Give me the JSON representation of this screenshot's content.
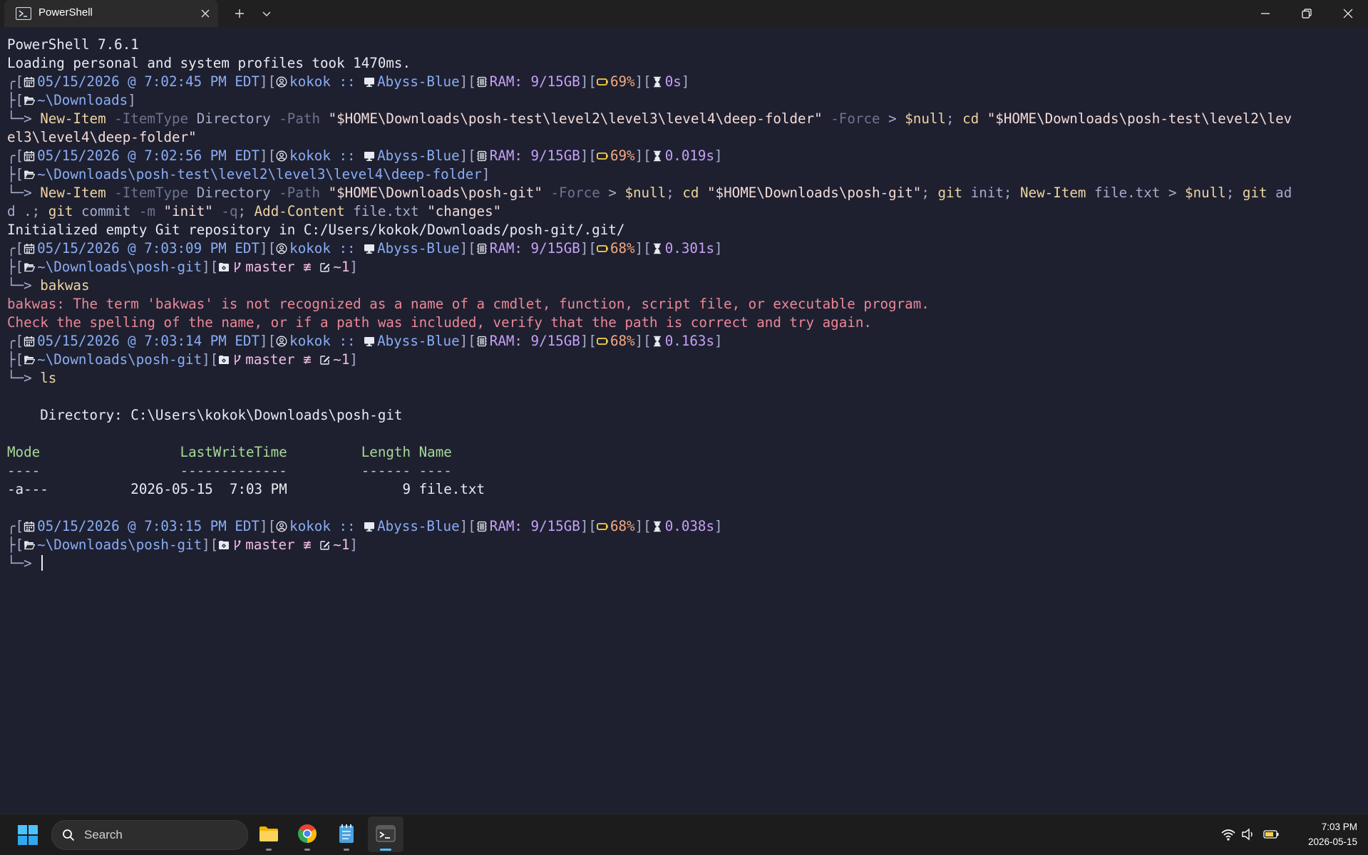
{
  "colors": {
    "terminal_bg": "#1e2030",
    "titlebar_bg": "#202020",
    "taskbar_bg": "#1c1c1c",
    "accent": "#4cc2ff",
    "error": "#ed8796"
  },
  "window": {
    "tab_title": "PowerShell",
    "tab_icon": "powershell-icon",
    "controls": [
      "minimize-icon",
      "restore-icon",
      "close-icon"
    ]
  },
  "terminal": {
    "lines": [
      {
        "kind": "text",
        "segs": [
          {
            "t": "PowerShell 7.6.1",
            "c": "white"
          }
        ]
      },
      {
        "kind": "text",
        "segs": [
          {
            "t": "Loading personal and system profiles took 1470ms.",
            "c": "white"
          }
        ]
      },
      {
        "kind": "prompt1",
        "date": "05/15/2026 @ 7:02:45 PM EDT",
        "user": "kokok",
        "host": "Abyss-Blue",
        "ram": "RAM: 9/15GB",
        "battery": "69%",
        "duration": "0s"
      },
      {
        "kind": "prompt2",
        "path": "~\\Downloads"
      },
      {
        "kind": "cmd",
        "arrow": "└─> ",
        "segs": [
          {
            "t": "New-Item",
            "c": "yellow"
          },
          {
            "t": " -ItemType",
            "c": "dim"
          },
          {
            "t": " Directory",
            "c": "gray"
          },
          {
            "t": " -Path",
            "c": "dim"
          },
          {
            "t": " \"$HOME\\Downloads\\posh-test\\level2\\level3\\level4\\deep-folder\"",
            "c": "rose"
          },
          {
            "t": " -Force",
            "c": "dim"
          },
          {
            "t": " >",
            "c": "gray"
          },
          {
            "t": " $null",
            "c": "yellow"
          },
          {
            "t": ";",
            "c": "gray"
          },
          {
            "t": " cd",
            "c": "yellow"
          },
          {
            "t": " \"$HOME\\Downloads\\posh-test\\level2\\lev",
            "c": "rose"
          }
        ]
      },
      {
        "kind": "text",
        "segs": [
          {
            "t": "el3\\level4\\deep-folder\"",
            "c": "rose"
          }
        ]
      },
      {
        "kind": "prompt1",
        "date": "05/15/2026 @ 7:02:56 PM EDT",
        "user": "kokok",
        "host": "Abyss-Blue",
        "ram": "RAM: 9/15GB",
        "battery": "69%",
        "duration": "0.019s"
      },
      {
        "kind": "prompt2",
        "path": "~\\Downloads\\posh-test\\level2\\level3\\level4\\deep-folder"
      },
      {
        "kind": "cmd",
        "arrow": "└─> ",
        "segs": [
          {
            "t": "New-Item",
            "c": "yellow"
          },
          {
            "t": " -ItemType",
            "c": "dim"
          },
          {
            "t": " Directory",
            "c": "gray"
          },
          {
            "t": " -Path",
            "c": "dim"
          },
          {
            "t": " \"$HOME\\Downloads\\posh-git\"",
            "c": "rose"
          },
          {
            "t": " -Force",
            "c": "dim"
          },
          {
            "t": " >",
            "c": "gray"
          },
          {
            "t": " $null",
            "c": "yellow"
          },
          {
            "t": ";",
            "c": "gray"
          },
          {
            "t": " cd",
            "c": "yellow"
          },
          {
            "t": " \"$HOME\\Downloads\\posh-git\"",
            "c": "rose"
          },
          {
            "t": ";",
            "c": "gray"
          },
          {
            "t": " git",
            "c": "yellow"
          },
          {
            "t": " init",
            "c": "gray"
          },
          {
            "t": ";",
            "c": "gray"
          },
          {
            "t": " New-Item",
            "c": "yellow"
          },
          {
            "t": " file.txt",
            "c": "gray"
          },
          {
            "t": " >",
            "c": "gray"
          },
          {
            "t": " $null",
            "c": "yellow"
          },
          {
            "t": ";",
            "c": "gray"
          },
          {
            "t": " git",
            "c": "yellow"
          },
          {
            "t": " ad",
            "c": "gray"
          }
        ]
      },
      {
        "kind": "text",
        "segs": [
          {
            "t": "d .;",
            "c": "gray"
          },
          {
            "t": " git",
            "c": "yellow"
          },
          {
            "t": " commit",
            "c": "gray"
          },
          {
            "t": " -m",
            "c": "dim"
          },
          {
            "t": " \"init\"",
            "c": "rose"
          },
          {
            "t": " -q",
            "c": "dim"
          },
          {
            "t": ";",
            "c": "gray"
          },
          {
            "t": " Add-Content",
            "c": "yellow"
          },
          {
            "t": " file.txt",
            "c": "gray"
          },
          {
            "t": " \"changes\"",
            "c": "rose"
          }
        ]
      },
      {
        "kind": "text",
        "segs": [
          {
            "t": "Initialized empty Git repository in C:/Users/kokok/Downloads/posh-git/.git/",
            "c": "white"
          }
        ]
      },
      {
        "kind": "prompt1",
        "date": "05/15/2026 @ 7:03:09 PM EDT",
        "user": "kokok",
        "host": "Abyss-Blue",
        "ram": "RAM: 9/15GB",
        "battery": "68%",
        "duration": "0.301s"
      },
      {
        "kind": "prompt2",
        "path": "~\\Downloads\\posh-git",
        "git": {
          "branch": "master",
          "status": "≢",
          "changes": "~1"
        }
      },
      {
        "kind": "cmd",
        "arrow": "└─> ",
        "segs": [
          {
            "t": "bakwas",
            "c": "yellow"
          }
        ]
      },
      {
        "kind": "text",
        "segs": [
          {
            "t": "bakwas: The term 'bakwas' is not recognized as a name of a cmdlet, function, script file, or executable program.",
            "c": "red"
          }
        ]
      },
      {
        "kind": "text",
        "segs": [
          {
            "t": "Check the spelling of the name, or if a path was included, verify that the path is correct and try again.",
            "c": "red"
          }
        ]
      },
      {
        "kind": "prompt1",
        "date": "05/15/2026 @ 7:03:14 PM EDT",
        "user": "kokok",
        "host": "Abyss-Blue",
        "ram": "RAM: 9/15GB",
        "battery": "68%",
        "duration": "0.163s"
      },
      {
        "kind": "prompt2",
        "path": "~\\Downloads\\posh-git",
        "git": {
          "branch": "master",
          "status": "≢",
          "changes": "~1"
        }
      },
      {
        "kind": "cmd",
        "arrow": "└─> ",
        "segs": [
          {
            "t": "ls",
            "c": "yellow"
          }
        ]
      },
      {
        "kind": "blank"
      },
      {
        "kind": "text",
        "segs": [
          {
            "t": "    Directory: C:\\Users\\kokok\\Downloads\\posh-git",
            "c": "white"
          }
        ]
      },
      {
        "kind": "blank"
      },
      {
        "kind": "text",
        "segs": [
          {
            "t": "Mode                 LastWriteTime         Length Name",
            "c": "green"
          }
        ]
      },
      {
        "kind": "text",
        "segs": [
          {
            "t": "----                 -------------         ------ ----",
            "c": "green"
          }
        ]
      },
      {
        "kind": "text",
        "segs": [
          {
            "t": "-a---          2026-05-15  7:03 PM              9 file.txt",
            "c": "white"
          }
        ]
      },
      {
        "kind": "blank"
      },
      {
        "kind": "prompt1",
        "date": "05/15/2026 @ 7:03:15 PM EDT",
        "user": "kokok",
        "host": "Abyss-Blue",
        "ram": "RAM: 9/15GB",
        "battery": "68%",
        "duration": "0.038s"
      },
      {
        "kind": "prompt2",
        "path": "~\\Downloads\\posh-git",
        "git": {
          "branch": "master",
          "status": "≢",
          "changes": "~1"
        }
      },
      {
        "kind": "cmd",
        "arrow": "└─> ",
        "segs": [],
        "cursor": true
      }
    ]
  },
  "taskbar": {
    "search_label": "Search",
    "apps": [
      "file-explorer-icon",
      "chrome-icon",
      "notepad-icon",
      "terminal-icon"
    ],
    "active_app": "terminal-icon",
    "tray": [
      "wifi-icon",
      "volume-icon",
      "battery-icon"
    ],
    "time": "7:03 PM",
    "date": "2026-05-15"
  }
}
